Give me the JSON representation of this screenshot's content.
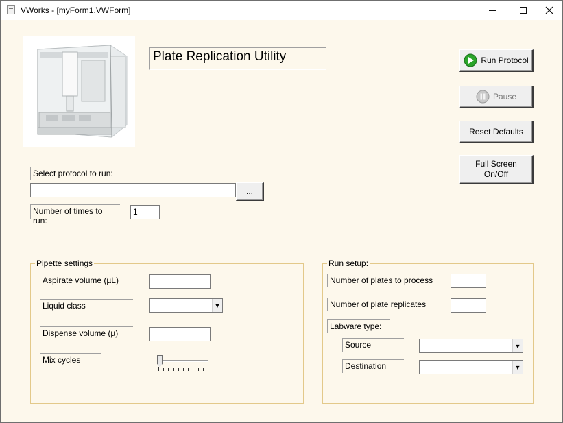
{
  "window": {
    "title": "VWorks - [myForm1.VWForm]"
  },
  "header": {
    "title": "Plate Replication Utility"
  },
  "buttons": {
    "run_protocol": "Run Protocol",
    "pause": "Pause",
    "reset_defaults": "Reset Defaults",
    "full_screen": "Full Screen On/Off",
    "browse": "..."
  },
  "protocol": {
    "select_label": "Select protocol to run:",
    "path_value": "",
    "times_label": "Number of times to run:",
    "times_value": "1"
  },
  "pipette": {
    "title": "Pipette settings",
    "aspirate_label": "Aspirate volume (µL)",
    "aspirate_value": "",
    "liquid_class_label": "Liquid class",
    "liquid_class_value": "",
    "dispense_label": "Dispense volume (µ)",
    "dispense_value": "",
    "mix_cycles_label": "Mix cycles",
    "mix_cycles_value": 0,
    "mix_cycles_max": 10
  },
  "run_setup": {
    "title": "Run setup:",
    "plates_label": "Number of plates to process",
    "plates_value": "",
    "replicates_label": "Number of plate replicates",
    "replicates_value": "",
    "labware_label": "Labware type:",
    "source_label": "Source",
    "source_value": "",
    "destination_label": "Destination",
    "destination_value": ""
  },
  "colors": {
    "form_background": "#fdf8ec",
    "group_border": "#e3c98a",
    "run_icon": "#2aa52a"
  },
  "icons": {
    "app": "form-icon",
    "run": "play-icon",
    "pause": "pause-icon"
  }
}
